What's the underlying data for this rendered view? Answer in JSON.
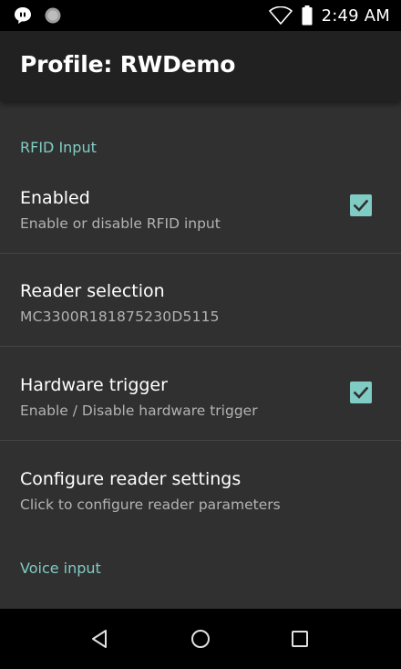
{
  "status_bar": {
    "time": "2:49 AM",
    "left_icons": [
      "notification-bubble-icon",
      "circle-status-icon"
    ],
    "right_icons": [
      "wifi-icon",
      "battery-icon"
    ]
  },
  "app_bar": {
    "title": "Profile: RWDemo"
  },
  "sections": [
    {
      "category": "RFID Input",
      "preferences": [
        {
          "title": "Enabled",
          "summary": "Enable or disable RFID input",
          "checkbox": true,
          "checked": true
        },
        {
          "title": "Reader selection",
          "summary": "MC3300R181875230D5115",
          "checkbox": false
        },
        {
          "title": "Hardware trigger",
          "summary": "Enable / Disable hardware trigger",
          "checkbox": true,
          "checked": true
        },
        {
          "title": "Configure reader settings",
          "summary": "Click to configure reader parameters",
          "checkbox": false
        }
      ]
    },
    {
      "category": "Voice input",
      "preferences": []
    }
  ],
  "nav_bar": {
    "buttons": [
      "back-icon",
      "home-icon",
      "recents-icon"
    ]
  },
  "colors": {
    "accent": "#80cbc4",
    "background": "#303030",
    "app_bar": "#212121",
    "summary_text": "#b3b3b3",
    "divider": "#454545"
  }
}
